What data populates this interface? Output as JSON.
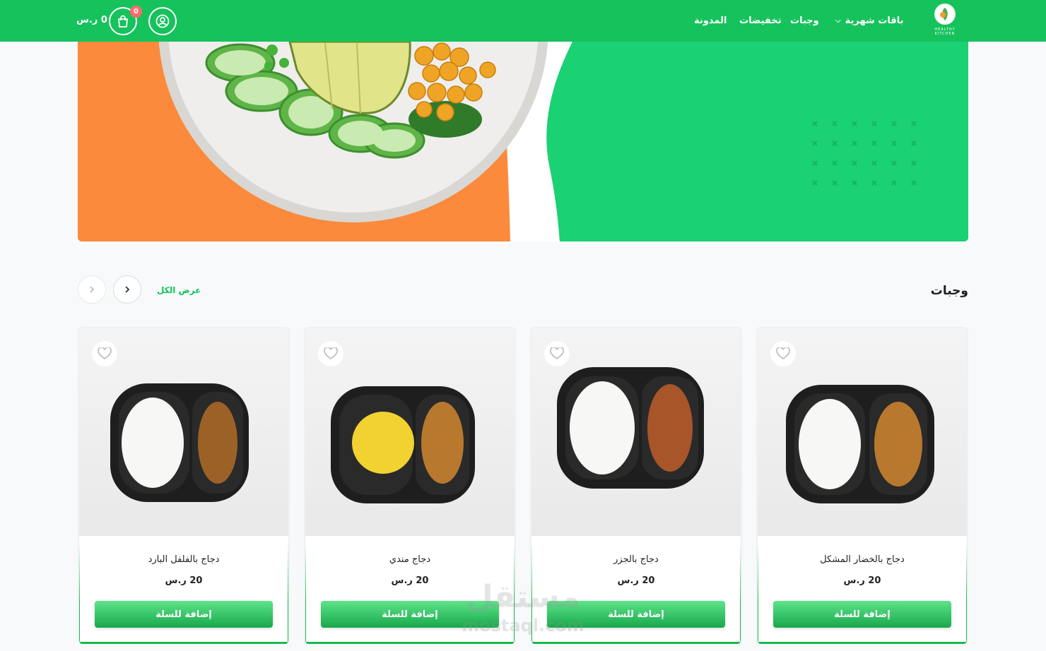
{
  "brand": {
    "logo_text": "HEALTHY KITCHEN"
  },
  "header": {
    "nav": {
      "monthly": "باقات شهرية",
      "meals": "وجبات",
      "offers": "تخفيضات",
      "blog": "المدونة"
    },
    "cart_count": "0",
    "cart_total": "0 ر.س"
  },
  "section": {
    "title": "وجبات",
    "view_all": "عرض الكل"
  },
  "products": [
    {
      "name": "دجاج بالخضار المشكل",
      "price": "20 ر.س",
      "button": "إضافة للسلة"
    },
    {
      "name": "دجاج بالجزر",
      "price": "20 ر.س",
      "button": "إضافة للسلة"
    },
    {
      "name": "دجاج مندي",
      "price": "20 ر.س",
      "button": "إضافة للسلة"
    },
    {
      "name": "دجاج بالفلفل البارد",
      "price": "20 ر.س",
      "button": "إضافة للسلة"
    }
  ],
  "watermark": {
    "arabic": "مستقل",
    "latin": "mostaql.com"
  },
  "colors": {
    "primary": "#16c25c",
    "hero_green": "#1ad173",
    "hero_orange": "#fb8a3c",
    "badge": "#ff6b6b"
  }
}
